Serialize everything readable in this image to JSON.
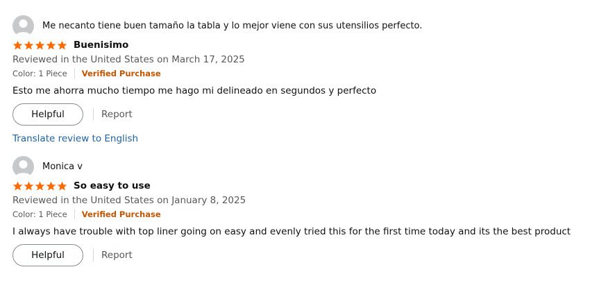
{
  "reviews": [
    {
      "reviewer": "Me necanto tiene buen tamaño la tabla y lo mejor viene con sus utensilios perfecto.",
      "rating_stars": 5,
      "title": "Buenisimo",
      "date_line": "Reviewed in the United States on March 17, 2025",
      "variant": "Color: 1 Piece",
      "verified": "Verified Purchase",
      "body": "Esto me ahorra mucho tiempo me hago mi delineado en segundos y perfecto",
      "helpful_label": "Helpful",
      "report_label": "Report",
      "translate_label": "Translate review to English"
    },
    {
      "reviewer": "Monica v",
      "rating_stars": 5,
      "title": "So easy to use",
      "date_line": "Reviewed in the United States on January 8, 2025",
      "variant": "Color: 1 Piece",
      "verified": "Verified Purchase",
      "body": "I always have trouble with top liner going on easy and evenly tried this for the first time today and its the best product",
      "helpful_label": "Helpful",
      "report_label": "Report"
    }
  ],
  "colors": {
    "star": "#ff6a00",
    "verified": "#c45500",
    "link": "#2162a1",
    "muted": "#565959"
  },
  "icons": {
    "avatar": "default-avatar-icon",
    "star": "star-icon"
  }
}
